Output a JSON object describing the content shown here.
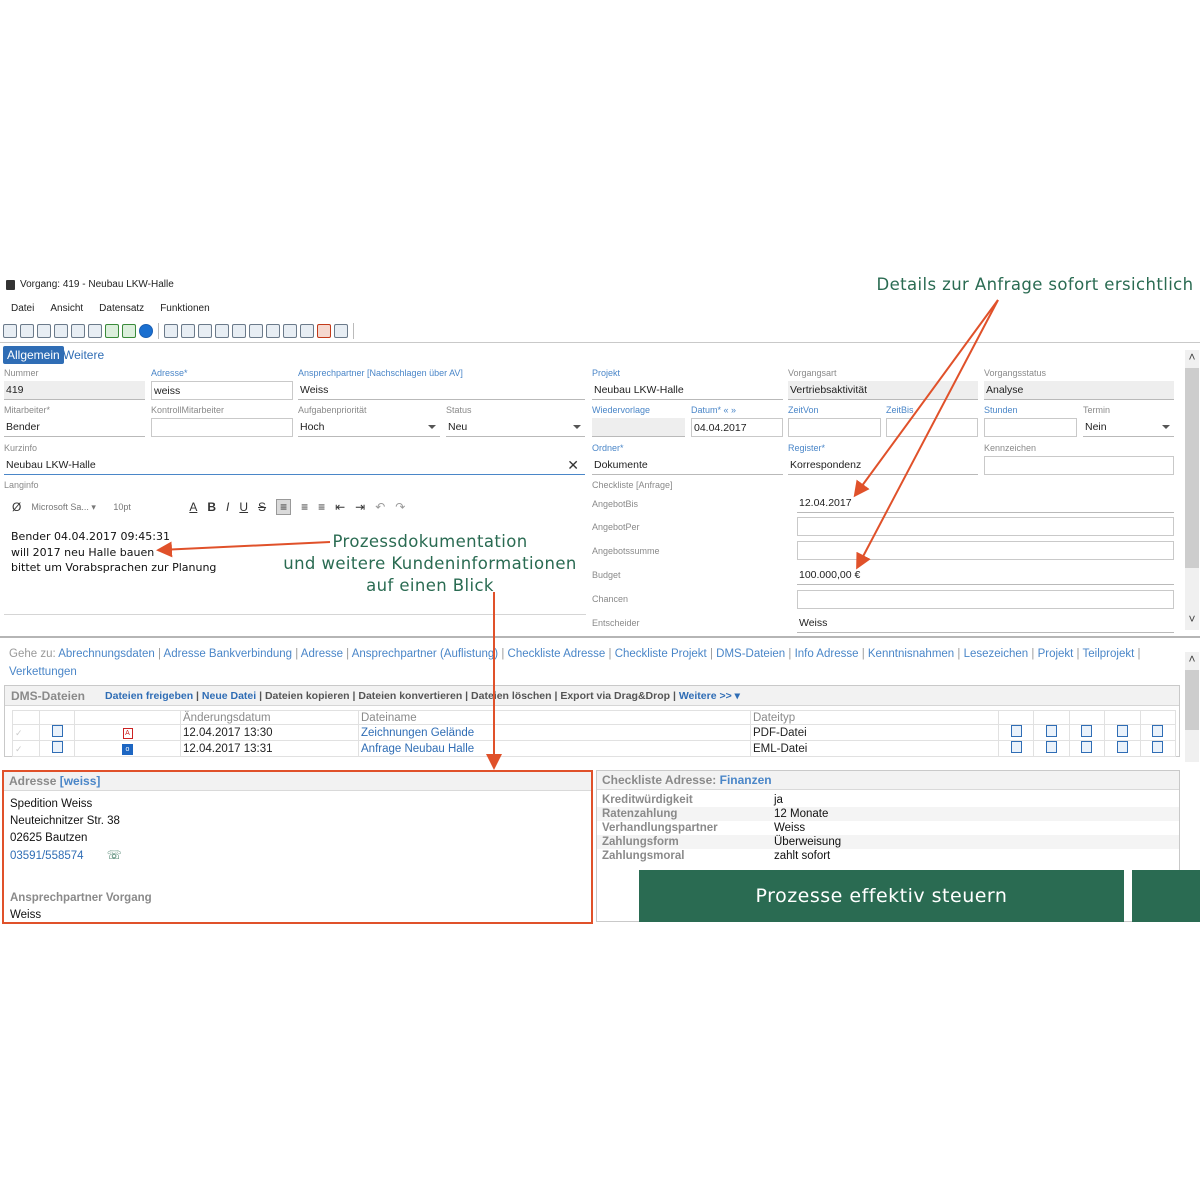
{
  "window": {
    "title": "Vorgang: 419 - Neubau LKW-Halle"
  },
  "menu": [
    "Datei",
    "Ansicht",
    "Datensatz",
    "Funktionen"
  ],
  "toolbar_icons": [
    "new-icon",
    "copy-icon",
    "save-icon",
    "filter-icon",
    "filter-remove-icon",
    "filter-apply-icon",
    "refresh-icon",
    "unlink-icon",
    "info-icon",
    "mail-icon",
    "edit-icon",
    "tree-icon",
    "list-icon",
    "hierarchy-icon",
    "hierarchy-alt-icon",
    "network-icon",
    "globe-icon",
    "calendar-icon",
    "delete-icon",
    "export-icon"
  ],
  "tabs": {
    "active": "Allgemein",
    "other": "Weitere"
  },
  "form": {
    "nummer": {
      "label": "Nummer",
      "value": "419"
    },
    "adresse": {
      "label": "Adresse*",
      "value": "weiss"
    },
    "ansprechpartner": {
      "label": "Ansprechpartner [Nachschlagen über AV]",
      "value": "Weiss"
    },
    "projekt": {
      "label": "Projekt",
      "value": "Neubau LKW-Halle"
    },
    "vorgangsart": {
      "label": "Vorgangsart",
      "value": "Vertriebsaktivität"
    },
    "vorgangsstatus": {
      "label": "Vorgangsstatus",
      "value": "Analyse"
    },
    "mitarbeiter": {
      "label": "Mitarbeiter*",
      "value": "Bender"
    },
    "kontrollmitarbeiter": {
      "label": "KontrollMitarbeiter",
      "value": ""
    },
    "aufgabenprioritaet": {
      "label": "Aufgabenpriorität",
      "value": "Hoch"
    },
    "status": {
      "label": "Status",
      "value": "Neu"
    },
    "wiedervorlage": {
      "label": "Wiedervorlage",
      "value": ""
    },
    "datum": {
      "label": "Datum* « »",
      "value": "04.04.2017"
    },
    "zeitvon": {
      "label": "ZeitVon",
      "value": ""
    },
    "zeitbis": {
      "label": "ZeitBis",
      "value": ""
    },
    "stunden": {
      "label": "Stunden",
      "value": ""
    },
    "termin": {
      "label": "Termin",
      "value": "Nein"
    },
    "kurzinfo": {
      "label": "Kurzinfo",
      "value": "Neubau LKW-Halle"
    },
    "ordner": {
      "label": "Ordner*",
      "value": "Dokumente"
    },
    "register": {
      "label": "Register*",
      "value": "Korrespondenz"
    },
    "kennzeichen": {
      "label": "Kennzeichen",
      "value": ""
    },
    "langinfo": {
      "label": "Langinfo"
    }
  },
  "editor": {
    "font": "Microsoft Sa...",
    "size": "10pt",
    "symbol": "Ø",
    "lines": [
      "Bender 04.04.2017 09:45:31",
      "will 2017 neu Halle bauen",
      "bittet um Vorabsprachen zur Planung"
    ]
  },
  "checkliste": {
    "label": "Checkliste [Anfrage]",
    "rows": [
      {
        "key": "AngebotBis",
        "value": "12.04.2017"
      },
      {
        "key": "AngebotPer",
        "value": ""
      },
      {
        "key": "Angebotssumme",
        "value": ""
      },
      {
        "key": "Budget",
        "value": "100.000,00 €"
      },
      {
        "key": "Chancen",
        "value": ""
      },
      {
        "key": "Entscheider",
        "value": "Weiss"
      }
    ]
  },
  "goto": {
    "prefix": "Gehe zu:",
    "links": [
      "Abrechnungsdaten",
      "Adresse Bankverbindung",
      "Adresse",
      "Ansprechpartner (Auflistung)",
      "Checkliste Adresse",
      "Checkliste Projekt",
      "DMS-Dateien",
      "Info Adresse",
      "Kenntnisnahmen",
      "Lesezeichen",
      "Projekt",
      "Teilprojekt",
      "Verkettungen"
    ]
  },
  "dms": {
    "title": "DMS-Dateien",
    "actions": [
      {
        "text": "Dateien freigeben",
        "link": true
      },
      {
        "text": "Neue Datei",
        "link": true
      },
      {
        "text": "Dateien kopieren",
        "link": false
      },
      {
        "text": "Dateien konvertieren",
        "link": false
      },
      {
        "text": "Dateien löschen",
        "link": false
      },
      {
        "text": "Export via Drag&Drop",
        "link": false
      },
      {
        "text": "Weitere >>",
        "link": true
      }
    ],
    "columns": [
      "Änderungsdatum",
      "Dateiname",
      "Dateityp"
    ],
    "rows": [
      {
        "date": "12.04.2017 13:30",
        "name": "Zeichnungen Gelände",
        "type": "PDF-Datei",
        "icon": "pdf-icon"
      },
      {
        "date": "12.04.2017 13:31",
        "name": "Anfrage Neubau Halle",
        "type": "EML-Datei",
        "icon": "outlook-icon"
      }
    ]
  },
  "address": {
    "title": "Adresse",
    "key": "[weiss]",
    "lines": [
      "Spedition Weiss",
      "Neuteichnitzer Str. 38",
      "02625 Bautzen"
    ],
    "phone": "03591/558574",
    "contact_label": "Ansprechpartner Vorgang",
    "contact": "Weiss"
  },
  "checklist_address": {
    "title": "Checkliste Adresse:",
    "section": "Finanzen",
    "rows": [
      {
        "key": "Kreditwürdigkeit",
        "value": "ja"
      },
      {
        "key": "Ratenzahlung",
        "value": "12 Monate"
      },
      {
        "key": "Verhandlungspartner",
        "value": "Weiss"
      },
      {
        "key": "Zahlungsform",
        "value": "Überweisung"
      },
      {
        "key": "Zahlungsmoral",
        "value": "zahlt sofort"
      }
    ]
  },
  "annotations": {
    "top_right": "Details zur Anfrage sofort ersichtlich",
    "middle": [
      "Prozessdokumentation",
      "und weitere Kundeninformationen",
      "auf einen Blick"
    ],
    "banner": "Prozesse effektiv steuern"
  },
  "colors": {
    "accent": "#2f6db5",
    "annotation_green": "#2a6b52",
    "annotation_arrow": "#e0512a"
  }
}
